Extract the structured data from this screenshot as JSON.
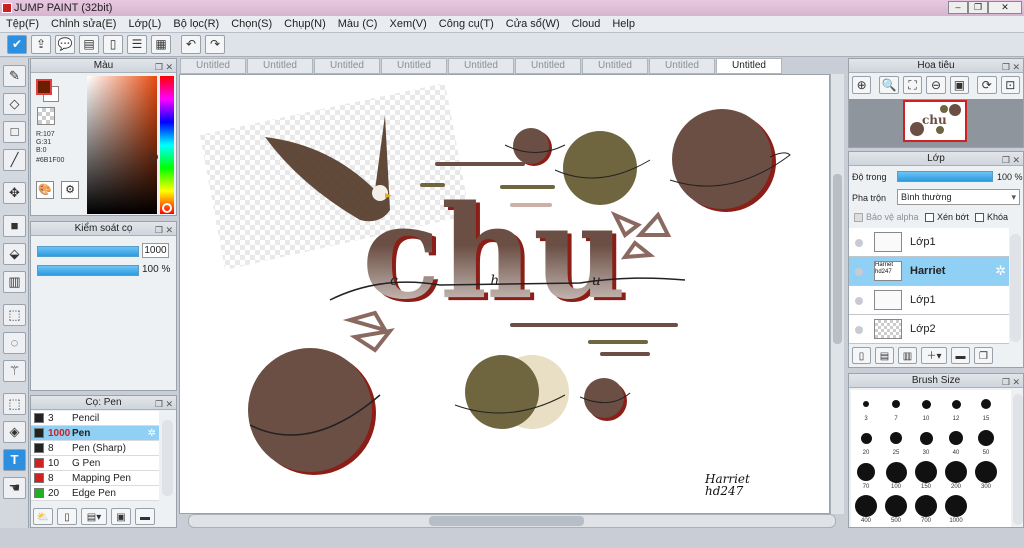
{
  "app": {
    "title": "JUMP PAINT (32bit)"
  },
  "menu": [
    "Tệp(F)",
    "Chỉnh sửa(E)",
    "Lớp(L)",
    "Bộ lọc(R)",
    "Chọn(S)",
    "Chụp(N)",
    "Màu (C)",
    "Xem(V)",
    "Công cụ(T)",
    "Cửa sổ(W)",
    "Cloud",
    "Help"
  ],
  "color_panel": {
    "title": "Màu",
    "r": "R:107",
    "g": "G:31",
    "b": "B:0",
    "hex": "#6B1F00",
    "fg": "#6B1F00"
  },
  "brush_control": {
    "title": "Kiểm soát cọ",
    "size": "1000",
    "opacity": "100 %"
  },
  "brush_panel": {
    "title": "Cọ: Pen",
    "items": [
      {
        "size": "3",
        "name": "Pencil",
        "color": "#222222"
      },
      {
        "size": "1000",
        "name": "Pen",
        "color": "#222222",
        "selected": true
      },
      {
        "size": "8",
        "name": "Pen (Sharp)",
        "color": "#222222"
      },
      {
        "size": "10",
        "name": "G Pen",
        "color": "#d02020"
      },
      {
        "size": "8",
        "name": "Mapping Pen",
        "color": "#d02020"
      },
      {
        "size": "20",
        "name": "Edge Pen",
        "color": "#20b020"
      }
    ]
  },
  "tabs": [
    "Untitled",
    "Untitled",
    "Untitled",
    "Untitled",
    "Untitled",
    "Untitled",
    "Untitled",
    "Untitled",
    "Untitled"
  ],
  "canvas": {
    "word": "chu",
    "script_letters": "c h u",
    "signature_line1": "Harriet",
    "signature_line2": "hd247"
  },
  "navigator": {
    "title": "Hoa tiêu"
  },
  "layers_panel": {
    "title": "Lớp",
    "opacity_label": "Độ trong",
    "opacity_value": "100 %",
    "blend_label": "Pha trộn",
    "blend_value": "Bình thường",
    "protect_alpha": "Bảo vệ alpha",
    "clip": "Xén bớt",
    "lock": "Khóa",
    "layers": [
      {
        "name": "Lớp1",
        "selected": false
      },
      {
        "name": "Harriet",
        "thumb": "Harriet hd247",
        "selected": true
      },
      {
        "name": "Lớp1",
        "selected": false
      },
      {
        "name": "Lớp2",
        "selected": false
      }
    ]
  },
  "brush_size_panel": {
    "title": "Brush Size",
    "sizes": [
      "3",
      "7",
      "10",
      "12",
      "15",
      "20",
      "25",
      "30",
      "40",
      "50",
      "70",
      "100",
      "150",
      "200",
      "300",
      "400",
      "500",
      "700",
      "1000"
    ]
  },
  "colors": {
    "accent": "#2d8fe0",
    "planet": "#6b4f45",
    "olive": "#6f6640",
    "cream": "#e8dfc4",
    "outline": "#b0201c"
  }
}
